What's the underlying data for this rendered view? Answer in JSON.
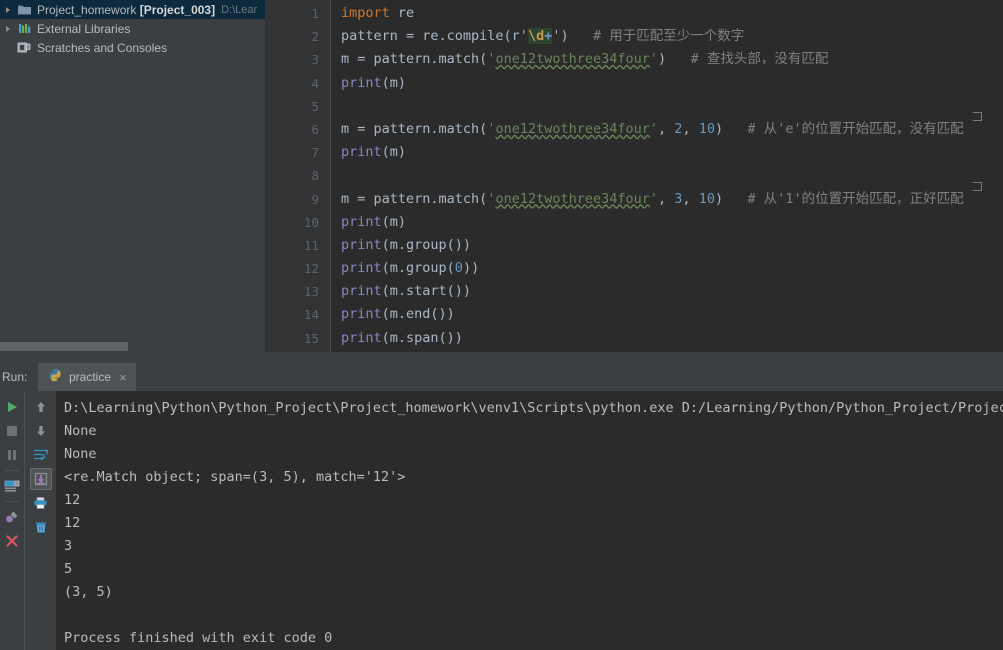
{
  "project_tree": {
    "items": [
      {
        "label": "Project_homework",
        "bold_label": "[Project_003]",
        "path": "D:\\Lear",
        "icon": "folder-icon",
        "selected": true,
        "expandable": true
      },
      {
        "label": "External Libraries",
        "icon": "library-icon",
        "selected": false,
        "expandable": true
      },
      {
        "label": "Scratches and Consoles",
        "icon": "scratches-icon",
        "selected": false,
        "expandable": false
      }
    ]
  },
  "editor": {
    "line_numbers": [
      "1",
      "2",
      "3",
      "4",
      "5",
      "6",
      "7",
      "8",
      "9",
      "10",
      "11",
      "12",
      "13",
      "14",
      "15"
    ],
    "lines": [
      {
        "n": 1,
        "text": "import re"
      },
      {
        "n": 2,
        "text": "pattern = re.compile(r'\\d+')   # 用于匹配至少一个数字"
      },
      {
        "n": 3,
        "text": "m = pattern.match('one12twothree34four')   # 查找头部，没有匹配"
      },
      {
        "n": 4,
        "text": "print(m)"
      },
      {
        "n": 5,
        "text": ""
      },
      {
        "n": 6,
        "text": "m = pattern.match('one12twothree34four', 2, 10)   # 从'e'的位置开始匹配，没有匹配"
      },
      {
        "n": 7,
        "text": "print(m)"
      },
      {
        "n": 8,
        "text": ""
      },
      {
        "n": 9,
        "text": "m = pattern.match('one12twothree34four', 3, 10)   # 从'1'的位置开始匹配，正好匹配"
      },
      {
        "n": 10,
        "text": "print(m)"
      },
      {
        "n": 11,
        "text": "print(m.group())"
      },
      {
        "n": 12,
        "text": "print(m.group(0))"
      },
      {
        "n": 13,
        "text": "print(m.start())"
      },
      {
        "n": 14,
        "text": "print(m.end())"
      },
      {
        "n": 15,
        "text": "print(m.span())"
      }
    ],
    "tokens": {
      "import_kw": "import",
      "module_re": " re",
      "pattern_assign": "pattern = re.compile(r'",
      "regex_escape": "\\d",
      "regex_quant": "+",
      "quote_close": "')",
      "comment_l2": "# 用于匹配至少一个数字",
      "match_prefix": "m = pattern.match('",
      "match_string": "one12twothree34four",
      "comment_l3": "# 查找头部，没有匹配",
      "comment_l6": "# 从'e'的位置开始匹配，没有匹配",
      "comment_l9": "# 从'1'的位置开始匹配，正好匹配",
      "print_fn": "print",
      "arg_m": "(m)",
      "arg_group": "(m.group())",
      "arg_group0_a": "(m.group(",
      "arg_group0_b": "0",
      "arg_group0_c": "))",
      "arg_start": "(m.start())",
      "arg_end": "(m.end())",
      "arg_span": "(m.span())",
      "num_2": "2",
      "num_3": "3",
      "num_10": "10",
      "comma_sp": ", ",
      "close_paren": ")",
      "quote_only": "'"
    }
  },
  "run_window": {
    "title": "Run:",
    "tab_label": "practice",
    "tab_close": "×",
    "tab_icon": "python-icon",
    "toolbar_left": [
      {
        "name": "rerun-button",
        "icon": "play-icon"
      },
      {
        "name": "stop-button",
        "icon": "stop-icon"
      },
      {
        "name": "pause-button",
        "icon": "pause-icon"
      },
      {
        "name": "console-button",
        "icon": "console-icon"
      },
      {
        "name": "attach-button",
        "icon": "plug-icon"
      },
      {
        "name": "close-button",
        "icon": "close-x-icon"
      }
    ],
    "toolbar_right": [
      {
        "name": "up-button",
        "icon": "arrow-up-icon"
      },
      {
        "name": "down-button",
        "icon": "arrow-down-icon"
      },
      {
        "name": "soft-wrap-button",
        "icon": "soft-wrap-icon"
      },
      {
        "name": "scroll-end-button",
        "icon": "scroll-to-end-icon",
        "pressed": true
      },
      {
        "name": "print-button",
        "icon": "printer-icon"
      },
      {
        "name": "clear-all-button",
        "icon": "trash-icon"
      }
    ],
    "console_output": [
      "D:\\Learning\\Python\\Python_Project\\Project_homework\\venv1\\Scripts\\python.exe D:/Learning/Python/Python_Project/Project",
      "None",
      "None",
      "<re.Match object; span=(3, 5), match='12'>",
      "12",
      "12",
      "3",
      "5",
      "(3, 5)",
      "",
      "Process finished with exit code 0"
    ]
  },
  "colors": {
    "editor_bg": "#2b2b2b",
    "panel_bg": "#3c3f41",
    "gutter_bg": "#313335",
    "selection_blue": "#0d293e",
    "keyword_orange": "#cc7832",
    "string_green": "#6a8759",
    "number_blue": "#6897bb",
    "function_purple": "#8888c6",
    "comment_gray": "#808080",
    "text_default": "#a9b7c6",
    "regex_bg": "#2f4430"
  }
}
